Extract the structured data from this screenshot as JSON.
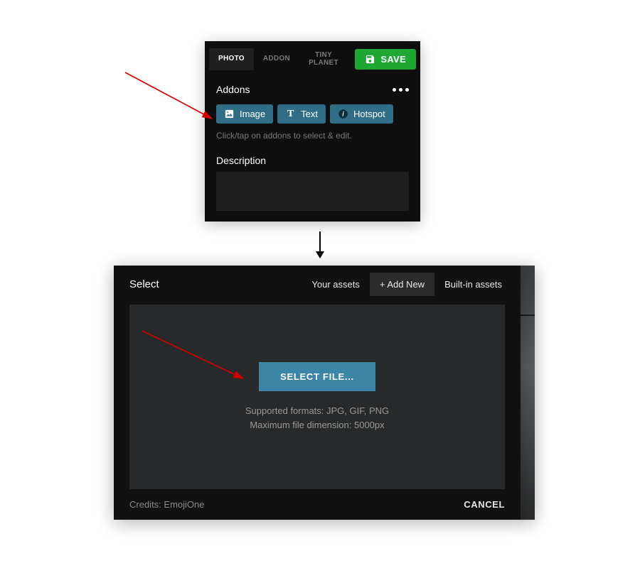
{
  "top_panel": {
    "tabs": {
      "photo": "PHOTO",
      "addon": "ADDON",
      "tiny_planet_line1": "TINY",
      "tiny_planet_line2": "PLANET"
    },
    "save_label": "SAVE",
    "addons_heading": "Addons",
    "pills": {
      "image": "Image",
      "text": "Text",
      "hotspot": "Hotspot"
    },
    "hint": "Click/tap on addons to select & edit.",
    "description_label": "Description"
  },
  "modal": {
    "title": "Select",
    "tabs": {
      "your_assets": "Your assets",
      "add_new": "+ Add New",
      "builtin": "Built-in assets"
    },
    "select_file_label": "SELECT FILE...",
    "formats_line": "Supported formats: JPG, GIF, PNG",
    "dimension_line": "Maximum file dimension: 5000px",
    "credits": "Credits: EmojiOne",
    "cancel_label": "CANCEL"
  }
}
